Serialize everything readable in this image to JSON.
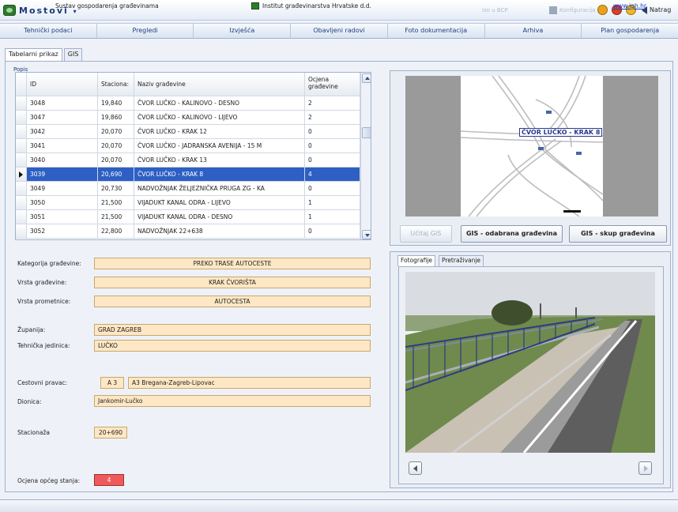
{
  "app": {
    "title": "Mostovi",
    "title_suffix": "▾",
    "toolbar_faint_1": "Izo u BCP",
    "toolbar_faint_2": "Konfiguracija",
    "back_label": "Natrag",
    "colors": {
      "accent": "#2d5fc4",
      "field_bg": "#fde7c4",
      "rating_bad": "#f05a5a",
      "link": "#1a3fbf"
    }
  },
  "main_menu": [
    {
      "label": "Tehnički podaci"
    },
    {
      "label": "Pregledi"
    },
    {
      "label": "Izvješća"
    },
    {
      "label": "Obavljeni radovi"
    },
    {
      "label": "Foto dokumentacija"
    },
    {
      "label": "Arhiva"
    },
    {
      "label": "Plan gospodarenja"
    }
  ],
  "sub_tabs": [
    {
      "label": "Tabelarni prikaz",
      "active": true
    },
    {
      "label": "GIS",
      "active": false
    }
  ],
  "popis": {
    "group_label": "Popis",
    "columns": [
      "ID",
      "Staciona:",
      "Naziv građevine",
      "Ocjena građevine"
    ],
    "rows": [
      {
        "id": "3048",
        "stacionaza": "19,840",
        "naziv": "ČVOR LUČKO - KALINOVO - DESNO",
        "ocjena": "2"
      },
      {
        "id": "3047",
        "stacionaza": "19,860",
        "naziv": "ČVOR LUČKO - KALINOVO - LIJEVO",
        "ocjena": "2"
      },
      {
        "id": "3042",
        "stacionaza": "20,070",
        "naziv": "ČVOR LUČKO - KRAK 12",
        "ocjena": "0"
      },
      {
        "id": "3041",
        "stacionaza": "20,070",
        "naziv": "ČVOR LUČKO - JADRANSKA AVENIJA - 15 M",
        "ocjena": "0"
      },
      {
        "id": "3040",
        "stacionaza": "20,070",
        "naziv": "ČVOR LUČKO - KRAK 13",
        "ocjena": "0"
      },
      {
        "id": "3039",
        "stacionaza": "20,690",
        "naziv": "ČVOR LUČKO - KRAK 8",
        "ocjena": "4",
        "selected": true
      },
      {
        "id": "3049",
        "stacionaza": "20,730",
        "naziv": "NADVOŽNJAK ŽELJEZNIČKA PRUGA ZG - KA",
        "ocjena": "0"
      },
      {
        "id": "3050",
        "stacionaza": "21,500",
        "naziv": "VIJADUKT KANAL ODRA - LIJEVO",
        "ocjena": "1"
      },
      {
        "id": "3051",
        "stacionaza": "21,500",
        "naziv": "VIJADUKT KANAL ODRA - DESNO",
        "ocjena": "1"
      },
      {
        "id": "3052",
        "stacionaza": "22,800",
        "naziv": "NADVOŽNJAK 22+638",
        "ocjena": "0"
      }
    ]
  },
  "details": {
    "kategorija": {
      "label": "Kategorija građevine:",
      "value": "PREKO TRASE AUTOCESTE"
    },
    "vrsta_gradevine": {
      "label": "Vrsta građevine:",
      "value": "KRAK ČVORIŠTA"
    },
    "vrsta_prometnice": {
      "label": "Vrsta prometnice:",
      "value": "AUTOCESTA"
    },
    "zupanija": {
      "label": "Županija:",
      "value": "GRAD ZAGREB"
    },
    "tehnicka_jedinica": {
      "label": "Tehnička jedinica:",
      "value": "LUČKO"
    },
    "cestovni_pravac": {
      "label": "Cestovni pravac:",
      "code": "A 3",
      "value": "A3 Bregana-Zagreb-Lipovac"
    },
    "dionica": {
      "label": "Dionica:",
      "value": "Jankomir-Lučko"
    },
    "stacionaza": {
      "label": "Stacionaža",
      "value": "20+690"
    },
    "ocjena": {
      "label": "Ocjena općeg stanja:",
      "value": "4"
    }
  },
  "gis": {
    "map_label": "ČVOR LUČKO - KRAK 8",
    "buttons": {
      "ucitaj": "Učitaj GIS",
      "odabrana": "GIS - odabrana građevina",
      "skup": "GIS - skup građevina"
    }
  },
  "photos": {
    "tabs": [
      {
        "label": "Fotografije",
        "active": true
      },
      {
        "label": "Pretraživanje",
        "active": false
      }
    ]
  },
  "status": {
    "left": "Sustav gospodarenja građevinama",
    "middle": "Institut građevinarstva Hrvatske d.d.",
    "link": "www.igh.hr"
  }
}
